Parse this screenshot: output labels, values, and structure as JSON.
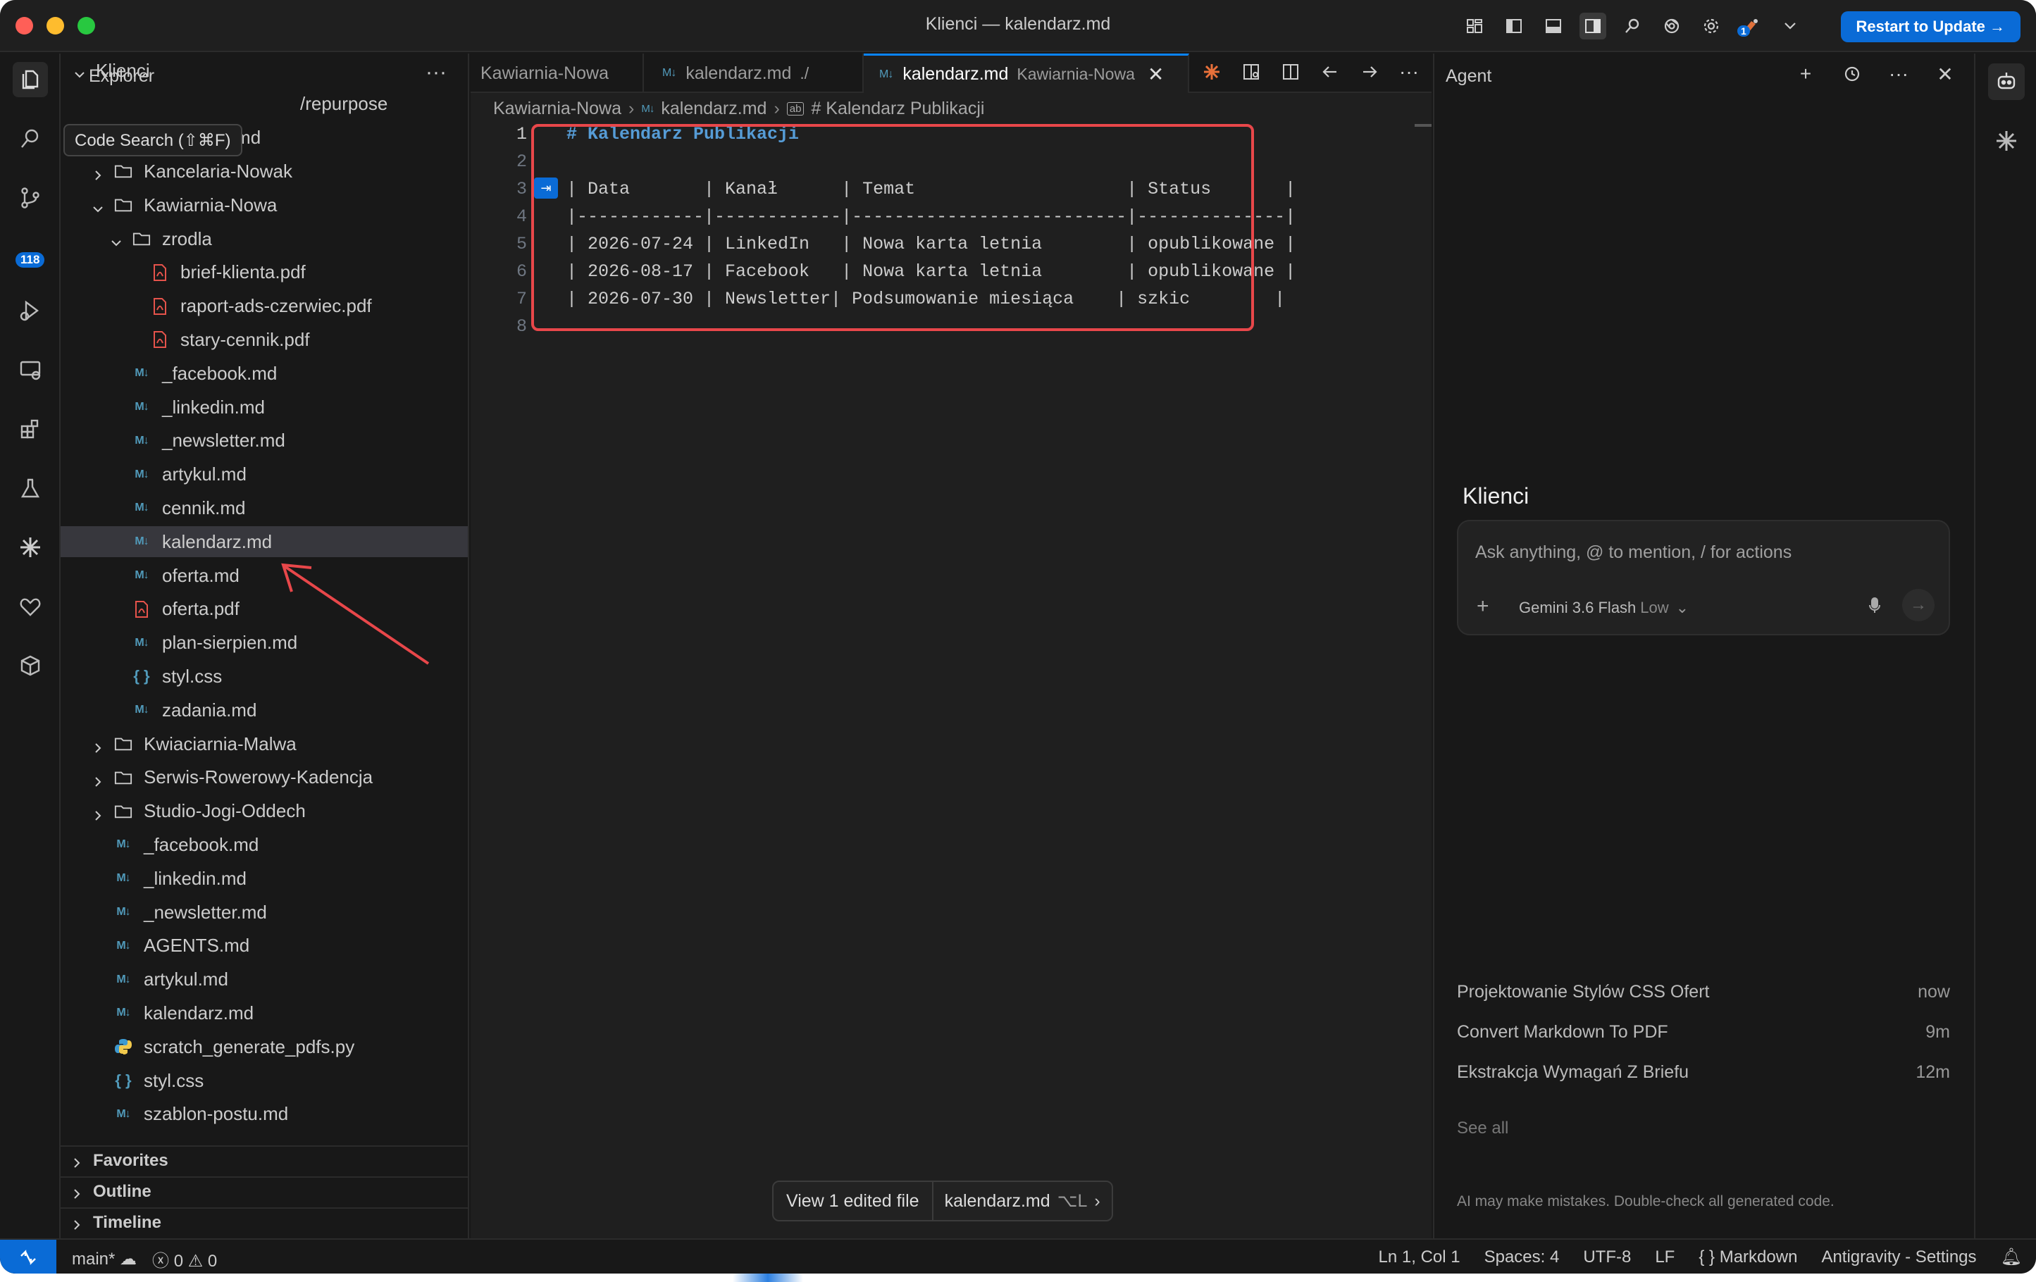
{
  "window": {
    "title": "Klienci — kalendarz.md"
  },
  "titlebar": {
    "update_label": "Restart to Update →",
    "notif_count": "1"
  },
  "activity": {
    "scm_badge": "118"
  },
  "tooltip": {
    "text": "Code Search (⇧⌘F)"
  },
  "explorer": {
    "title": "Explorer",
    "more": "···",
    "rows": [
      {
        "label": "Klienci",
        "indent": 0,
        "type": "chev-open"
      },
      {
        "label": "/repurpose",
        "indent": 2,
        "type": "partial"
      },
      {
        "label": "SKILL.md",
        "indent": 3,
        "type": "md"
      },
      {
        "label": "Kancelaria-Nowak",
        "indent": 1,
        "type": "folder-closed"
      },
      {
        "label": "Kawiarnia-Nowa",
        "indent": 1,
        "type": "folder-open"
      },
      {
        "label": "zrodla",
        "indent": 2,
        "type": "folder-open"
      },
      {
        "label": "brief-klienta.pdf",
        "indent": 3,
        "type": "pdf"
      },
      {
        "label": "raport-ads-czerwiec.pdf",
        "indent": 3,
        "type": "pdf"
      },
      {
        "label": "stary-cennik.pdf",
        "indent": 3,
        "type": "pdf"
      },
      {
        "label": "_facebook.md",
        "indent": 2,
        "type": "md"
      },
      {
        "label": "_linkedin.md",
        "indent": 2,
        "type": "md"
      },
      {
        "label": "_newsletter.md",
        "indent": 2,
        "type": "md"
      },
      {
        "label": "artykul.md",
        "indent": 2,
        "type": "md"
      },
      {
        "label": "cennik.md",
        "indent": 2,
        "type": "md"
      },
      {
        "label": "kalendarz.md",
        "indent": 2,
        "type": "md",
        "selected": true
      },
      {
        "label": "oferta.md",
        "indent": 2,
        "type": "md"
      },
      {
        "label": "oferta.pdf",
        "indent": 2,
        "type": "pdf"
      },
      {
        "label": "plan-sierpien.md",
        "indent": 2,
        "type": "md"
      },
      {
        "label": "styl.css",
        "indent": 2,
        "type": "css"
      },
      {
        "label": "zadania.md",
        "indent": 2,
        "type": "md"
      },
      {
        "label": "Kwiaciarnia-Malwa",
        "indent": 1,
        "type": "folder-closed"
      },
      {
        "label": "Serwis-Rowerowy-Kadencja",
        "indent": 1,
        "type": "folder-closed"
      },
      {
        "label": "Studio-Jogi-Oddech",
        "indent": 1,
        "type": "folder-closed"
      },
      {
        "label": "_facebook.md",
        "indent": 1,
        "type": "md"
      },
      {
        "label": "_linkedin.md",
        "indent": 1,
        "type": "md"
      },
      {
        "label": "_newsletter.md",
        "indent": 1,
        "type": "md"
      },
      {
        "label": "AGENTS.md",
        "indent": 1,
        "type": "md"
      },
      {
        "label": "artykul.md",
        "indent": 1,
        "type": "md"
      },
      {
        "label": "kalendarz.md",
        "indent": 1,
        "type": "md"
      },
      {
        "label": "scratch_generate_pdfs.py",
        "indent": 1,
        "type": "py"
      },
      {
        "label": "styl.css",
        "indent": 1,
        "type": "css"
      },
      {
        "label": "szablon-postu.md",
        "indent": 1,
        "type": "md"
      }
    ],
    "sections": [
      "Favorites",
      "Outline",
      "Timeline"
    ]
  },
  "editor": {
    "tabs": [
      {
        "label": "Kawiarnia-Nowa",
        "sub": "",
        "icon": ""
      },
      {
        "label": "kalendarz.md",
        "sub": "./",
        "icon": "M↓"
      },
      {
        "label": "kalendarz.md",
        "sub": "Kawiarnia-Nowa",
        "icon": "M↓",
        "active": true
      }
    ],
    "breadcrumb": [
      "Kawiarnia-Nowa",
      "kalendarz.md",
      "# Kalendarz Publikacji"
    ],
    "lines": [
      "# Kalendarz Publikacji",
      "",
      "| Data       | Kanał      | Temat                    | Status       |",
      "|------------|------------|--------------------------|--------------|",
      "| 2026-07-24 | LinkedIn   | Nowa karta letnia        | opublikowane |",
      "| 2026-08-17 | Facebook   | Nowa karta letnia        | opublikowane |",
      "| 2026-07-30 | Newsletter| Podsumowanie miesiąca    | szkic        |",
      ""
    ],
    "line_numbers": [
      "1",
      "2",
      "3",
      "4",
      "5",
      "6",
      "7",
      "8"
    ],
    "chip": {
      "edited": "View 1 edited file",
      "file": "kalendarz.md",
      "shortcut": "⌥L"
    }
  },
  "agent": {
    "title": "Agent",
    "workspace": "Klienci",
    "placeholder": "Ask anything, @ to mention, / for actions",
    "model": "Gemini 3.6 Flash",
    "level": "Low",
    "conversations": [
      {
        "title": "Projektowanie Stylów CSS Ofert",
        "time": "now"
      },
      {
        "title": "Convert Markdown To PDF",
        "time": "9m"
      },
      {
        "title": "Ekstrakcja Wymagań Z Briefu",
        "time": "12m"
      }
    ],
    "see_all": "See all",
    "disclaimer": "AI may make mistakes. Double-check all generated code."
  },
  "status": {
    "branch": "main*",
    "errors": "0",
    "warnings": "0",
    "position": "Ln 1, Col 1",
    "spaces": "Spaces: 4",
    "encoding": "UTF-8",
    "eol": "LF",
    "language": "Markdown",
    "settings": "Antigravity - Settings"
  },
  "colors": {
    "accent": "#0a6bd6",
    "annotation": "#e8474a",
    "background": "#181818"
  }
}
